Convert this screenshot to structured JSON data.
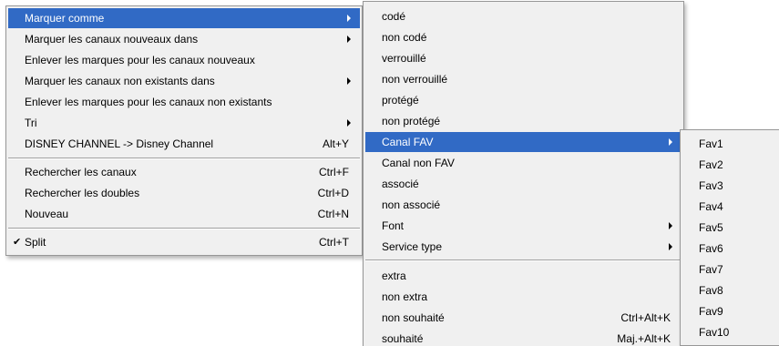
{
  "menu_main": {
    "items": [
      {
        "label": "Marquer comme",
        "shortcut": "",
        "submenu": true,
        "selected": true
      },
      {
        "label": "Marquer les canaux nouveaux dans",
        "shortcut": "",
        "submenu": true
      },
      {
        "label": "Enlever les marques pour les canaux nouveaux",
        "shortcut": ""
      },
      {
        "label": "Marquer les canaux non existants dans",
        "shortcut": "",
        "submenu": true
      },
      {
        "label": "Enlever les marques pour les canaux non existants",
        "shortcut": ""
      },
      {
        "label": "Tri",
        "shortcut": "",
        "submenu": true
      },
      {
        "label": "DISNEY CHANNEL -> Disney Channel",
        "shortcut": "Alt+Y"
      },
      {
        "label": "Rechercher les canaux",
        "shortcut": "Ctrl+F"
      },
      {
        "label": "Rechercher les doubles",
        "shortcut": "Ctrl+D"
      },
      {
        "label": "Nouveau",
        "shortcut": "Ctrl+N"
      },
      {
        "label": "Split",
        "shortcut": "Ctrl+T",
        "checked": true,
        "check_mark": "✔"
      }
    ]
  },
  "menu_mark_as": {
    "items": [
      {
        "label": "codé",
        "shortcut": ""
      },
      {
        "label": "non codé",
        "shortcut": ""
      },
      {
        "label": "verrouillé",
        "shortcut": ""
      },
      {
        "label": "non verrouillé",
        "shortcut": ""
      },
      {
        "label": "protégé",
        "shortcut": ""
      },
      {
        "label": "non protégé",
        "shortcut": ""
      },
      {
        "label": "Canal FAV",
        "shortcut": "",
        "submenu": true,
        "selected": true
      },
      {
        "label": "Canal non FAV",
        "shortcut": ""
      },
      {
        "label": "associé",
        "shortcut": ""
      },
      {
        "label": "non associé",
        "shortcut": ""
      },
      {
        "label": "Font",
        "shortcut": "",
        "submenu": true
      },
      {
        "label": "Service type",
        "shortcut": "",
        "submenu": true
      },
      {
        "label": "extra",
        "shortcut": ""
      },
      {
        "label": "non extra",
        "shortcut": ""
      },
      {
        "label": "non souhaité",
        "shortcut": "Ctrl+Alt+K"
      },
      {
        "label": "souhaité",
        "shortcut": "Maj.+Alt+K"
      }
    ]
  },
  "menu_fav": {
    "items": [
      "Fav1",
      "Fav2",
      "Fav3",
      "Fav4",
      "Fav5",
      "Fav6",
      "Fav7",
      "Fav8",
      "Fav9",
      "Fav10"
    ]
  },
  "colors": {
    "menu_background": "#f0f0f0",
    "highlight": "#316ac5",
    "highlight_text": "#ffffff",
    "border": "#979797"
  }
}
